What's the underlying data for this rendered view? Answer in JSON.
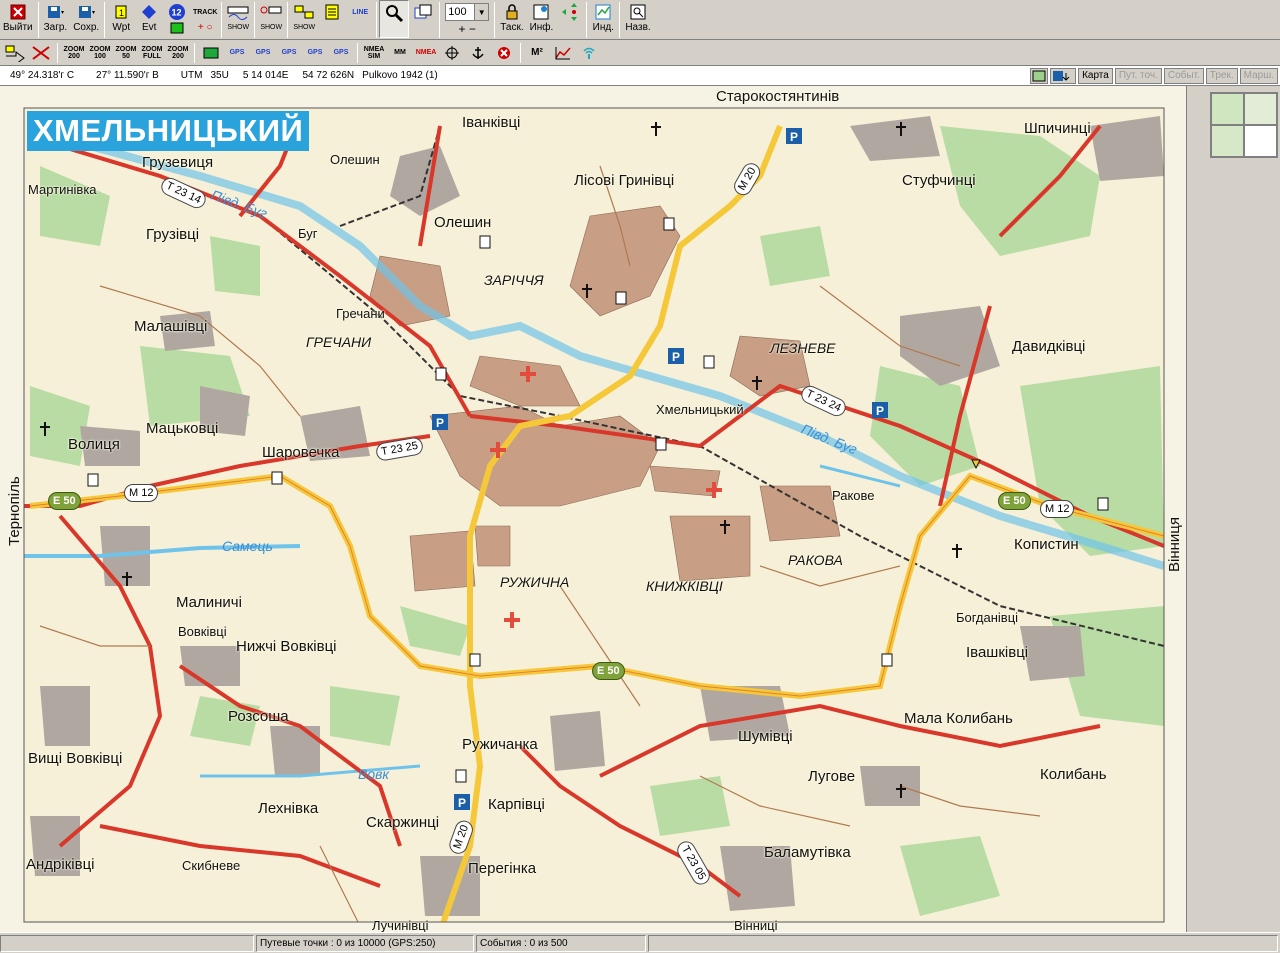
{
  "toolbar_main": [
    {
      "name": "exit-button",
      "label": "Выйти",
      "icon": "exit-icon"
    },
    {
      "name": "load-button",
      "label": "Загр.",
      "icon": "load-icon"
    },
    {
      "name": "save-button",
      "label": "Сохр.",
      "icon": "save-icon"
    },
    {
      "name": "wpt-button",
      "label": "Wpt",
      "icon": "waypoint-icon"
    },
    {
      "name": "evt-button",
      "label": "Evt",
      "icon": "event-icon"
    },
    {
      "name": "tasks-button",
      "label": "Таск.",
      "icon": "lock-icon"
    },
    {
      "name": "info-button",
      "label": "Инф.",
      "icon": "info-icon"
    },
    {
      "name": "ind-button",
      "label": "Инд.",
      "icon": "indicator-icon"
    },
    {
      "name": "names-button",
      "label": "Назв.",
      "icon": "names-icon"
    }
  ],
  "toolbar_small_labels": {
    "badge_12": "12",
    "track": "TRACK",
    "show1": "SHOW",
    "show2": "SHOW",
    "show3": "SHOW",
    "line": "LINE"
  },
  "zoom_value": "100",
  "toolbar_secondary": [
    {
      "name": "zoom-200-button",
      "label": "ZOOM 200"
    },
    {
      "name": "zoom-100-button",
      "label": "ZOOM 100"
    },
    {
      "name": "zoom-50-button",
      "label": "ZOOM 50"
    },
    {
      "name": "zoom-full-button",
      "label": "ZOOM FULL"
    },
    {
      "name": "zoom-200b-button",
      "label": "ZOOM 200"
    },
    {
      "name": "gps-1-button",
      "label": "GPS"
    },
    {
      "name": "gps-2-button",
      "label": "GPS"
    },
    {
      "name": "gps-3-button",
      "label": "GPS"
    },
    {
      "name": "gps-4-button",
      "label": "GPS"
    },
    {
      "name": "gps-5-button",
      "label": "GPS"
    },
    {
      "name": "nmea-sim-button",
      "label": "NMEA SIM"
    },
    {
      "name": "mm-button",
      "label": "MM"
    },
    {
      "name": "nmea-button",
      "label": "NMEA"
    },
    {
      "name": "m2-button",
      "label": "M²"
    }
  ],
  "coords": {
    "lat": "49° 24.318'г С",
    "lon": "27° 11.590'г В",
    "utm_label": "UTM",
    "zone": "35U",
    "easting": "5 14 014E",
    "northing": "54 72 626N",
    "datum": "Pulkovo 1942 (1)"
  },
  "view_buttons": [
    {
      "name": "map-tab",
      "label": "Карта",
      "enabled": true
    },
    {
      "name": "waypoints-tab",
      "label": "Пут. точ.",
      "enabled": false
    },
    {
      "name": "events-tab",
      "label": "Событ.",
      "enabled": false
    },
    {
      "name": "tracks-tab",
      "label": "Трек.",
      "enabled": false
    },
    {
      "name": "routes-tab",
      "label": "Марш.",
      "enabled": false
    }
  ],
  "map": {
    "title": "ХМЕЛЬНИЦЬКИЙ",
    "edge_labels": {
      "north": "Старокостянтинів",
      "west": "Тернопіль",
      "east": "Вінниця",
      "south_left": "Лучинівці",
      "south_right": "Вінниці"
    },
    "places": [
      {
        "name": "Іванківці",
        "style": "normal"
      },
      {
        "name": "Грузевиця",
        "style": "normal"
      },
      {
        "name": "Мартинівка",
        "style": "small"
      },
      {
        "name": "Олешин",
        "style": "small"
      },
      {
        "name": "Олешин",
        "style": "normal"
      },
      {
        "name": "Лісові Гринівці",
        "style": "normal"
      },
      {
        "name": "Шпичинці",
        "style": "normal"
      },
      {
        "name": "Стуфчинці",
        "style": "normal"
      },
      {
        "name": "Грузівці",
        "style": "normal"
      },
      {
        "name": "Буг",
        "style": "small"
      },
      {
        "name": "ЗАРІЧЧЯ",
        "style": "ital"
      },
      {
        "name": "Малашівці",
        "style": "normal"
      },
      {
        "name": "Гречани",
        "style": "small"
      },
      {
        "name": "ГРЕЧАНИ",
        "style": "ital"
      },
      {
        "name": "ЛЕЗНЕВЕ",
        "style": "ital"
      },
      {
        "name": "Давидківці",
        "style": "normal"
      },
      {
        "name": "Волиця",
        "style": "normal"
      },
      {
        "name": "Мацьковці",
        "style": "normal"
      },
      {
        "name": "Шаровечка",
        "style": "normal"
      },
      {
        "name": "Хмельницький",
        "style": "small"
      },
      {
        "name": "Ракове",
        "style": "small"
      },
      {
        "name": "РАКОВА",
        "style": "ital"
      },
      {
        "name": "Копистин",
        "style": "normal"
      },
      {
        "name": "РУЖИЧНА",
        "style": "ital"
      },
      {
        "name": "КНИЖКІВЦІ",
        "style": "ital"
      },
      {
        "name": "Малиничі",
        "style": "normal"
      },
      {
        "name": "Вовківці",
        "style": "small"
      },
      {
        "name": "Нижчі Вовківці",
        "style": "normal"
      },
      {
        "name": "Богданівці",
        "style": "small"
      },
      {
        "name": "Івашківці",
        "style": "normal"
      },
      {
        "name": "Розсоша",
        "style": "normal"
      },
      {
        "name": "Мала Колибань",
        "style": "normal"
      },
      {
        "name": "Шумівці",
        "style": "normal"
      },
      {
        "name": "Ружичанка",
        "style": "normal"
      },
      {
        "name": "Вищі Вовківці",
        "style": "normal"
      },
      {
        "name": "Лугове",
        "style": "normal"
      },
      {
        "name": "Колибань",
        "style": "normal"
      },
      {
        "name": "Лехнівка",
        "style": "normal"
      },
      {
        "name": "Карпівці",
        "style": "normal"
      },
      {
        "name": "Скаржинці",
        "style": "normal"
      },
      {
        "name": "Баламутівка",
        "style": "normal"
      },
      {
        "name": "Андріківці",
        "style": "normal"
      },
      {
        "name": "Скибневе",
        "style": "small"
      },
      {
        "name": "Перегінка",
        "style": "normal"
      }
    ],
    "rivers": [
      "Півд. Буг",
      "Півд. Буг",
      "Самець",
      "Вовк"
    ],
    "roads": [
      "T 23 14",
      "M 20",
      "T 23 25",
      "T 23 24",
      "M 12",
      "E 50",
      "M 12",
      "E 50",
      "E 50",
      "M 20",
      "T 23 05"
    ]
  },
  "status": {
    "waypoints": "Путевые точки : 0 из 10000  (GPS:250)",
    "events": "События : 0 из 500"
  },
  "colors": {
    "title_bg": "#2aa3dc",
    "road_major": "#f5c83a",
    "road_red": "#d8372a",
    "water": "#6fc3ea",
    "forest": "#b9dca4",
    "urban": "#c89e84",
    "bg_land": "#f6f2e4"
  }
}
